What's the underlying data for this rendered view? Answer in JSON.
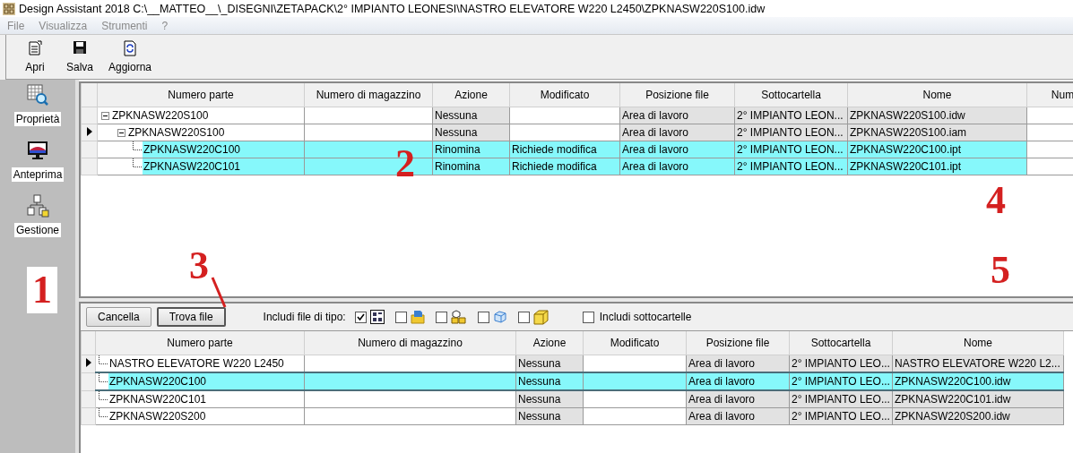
{
  "window": {
    "title": "Design Assistant 2018 C:\\__MATTEO__\\_DISEGNI\\ZETAPACK\\2° IMPIANTO LEONESI\\NASTRO ELEVATORE W220 L2450\\ZPKNASW220S100.idw"
  },
  "menu": [
    {
      "label": "File",
      "disabled": true
    },
    {
      "label": "Visualizza",
      "disabled": true
    },
    {
      "label": "Strumenti",
      "disabled": true
    },
    {
      "label": "?",
      "disabled": true
    }
  ],
  "toolbar": [
    {
      "label": "Apri",
      "kind": "open"
    },
    {
      "label": "Salva",
      "kind": "save"
    },
    {
      "label": "Aggiorna",
      "kind": "refresh"
    }
  ],
  "sidebar": {
    "items": [
      {
        "label": "Proprietà",
        "kind": "properties"
      },
      {
        "label": "Anteprima",
        "kind": "preview"
      },
      {
        "label": "Gestione",
        "kind": "manage"
      }
    ]
  },
  "top_table": {
    "columns": [
      {
        "label": "Numero parte",
        "kind": "tree"
      },
      {
        "label": "Numero di magazzino",
        "kind": "edit"
      },
      {
        "label": "Azione",
        "kind": "readonly"
      },
      {
        "label": "Modificato",
        "kind": "edit"
      },
      {
        "label": "Posizione file",
        "kind": "readonly"
      },
      {
        "label": "Sottocartella",
        "kind": "readonly"
      },
      {
        "label": "Nome",
        "kind": "readonly"
      },
      {
        "label": "Num",
        "kind": "plain"
      }
    ],
    "rows": [
      {
        "cells": [
          "ZPKNASW220S100",
          null,
          "Nessuna",
          null,
          "Area di lavoro",
          "2° IMPIANTO LEON...",
          "ZPKNASW220S100.idw",
          null
        ],
        "current": false,
        "selected": false,
        "expanded": true,
        "children": [
          {
            "cells": [
              "ZPKNASW220S100",
              null,
              "Nessuna",
              null,
              "Area di lavoro",
              "2° IMPIANTO LEON...",
              "ZPKNASW220S100.iam",
              null
            ],
            "current": true,
            "selected": false,
            "expanded": true,
            "children": [
              {
                "cells": [
                  "ZPKNASW220C100",
                  null,
                  "Rinomina",
                  "Richiede modifica",
                  "Area di lavoro",
                  "2° IMPIANTO LEON...",
                  "ZPKNASW220C100.ipt",
                  null
                ],
                "current": false,
                "selected": true
              },
              {
                "cells": [
                  "ZPKNASW220C101",
                  null,
                  "Rinomina",
                  "Richiede modifica",
                  "Area di lavoro",
                  "2° IMPIANTO LEON...",
                  "ZPKNASW220C101.ipt",
                  null
                ],
                "current": false,
                "selected": true
              }
            ]
          }
        ]
      }
    ]
  },
  "search_bar": {
    "buttons": [
      {
        "label": "Cancella",
        "default": false
      },
      {
        "label": "Trova file",
        "default": true
      }
    ],
    "file_types_label": "Includi file di tipo:",
    "file_types": [
      {
        "kind": "drawing",
        "checked": true
      },
      {
        "kind": "presentation",
        "checked": false
      },
      {
        "kind": "assembly",
        "checked": false
      },
      {
        "kind": "surface",
        "checked": false
      },
      {
        "kind": "part",
        "checked": false
      }
    ],
    "subfolders": {
      "label": "Includi sottocartelle",
      "checked": false
    }
  },
  "bottom_table": {
    "columns": [
      {
        "label": "Numero parte",
        "kind": "tree"
      },
      {
        "label": "Numero di magazzino",
        "kind": "edit"
      },
      {
        "label": "Azione",
        "kind": "readonly"
      },
      {
        "label": "Modificato",
        "kind": "edit"
      },
      {
        "label": "Posizione file",
        "kind": "readonly"
      },
      {
        "label": "Sottocartella",
        "kind": "readonly"
      },
      {
        "label": "Nome",
        "kind": "readonly"
      }
    ],
    "rows": [
      {
        "cells": [
          "NASTRO ELEVATORE W220 L2450",
          null,
          "Nessuna",
          null,
          "Area di lavoro",
          "2° IMPIANTO LEO...",
          "NASTRO ELEVATORE W220 L2..."
        ],
        "current": true,
        "selected": false
      },
      {
        "cells": [
          "ZPKNASW220C100",
          null,
          "Nessuna",
          null,
          "Area di lavoro",
          "2° IMPIANTO LEO...",
          "ZPKNASW220C100.idw"
        ],
        "current": false,
        "selected": true
      },
      {
        "cells": [
          "ZPKNASW220C101",
          null,
          "Nessuna",
          null,
          "Area di lavoro",
          "2° IMPIANTO LEO...",
          "ZPKNASW220C101.idw"
        ],
        "current": false,
        "selected": false
      },
      {
        "cells": [
          "ZPKNASW220S200",
          null,
          "Nessuna",
          null,
          "Area di lavoro",
          "2° IMPIANTO LEO...",
          "ZPKNASW220S200.idw"
        ],
        "current": false,
        "selected": false
      }
    ]
  },
  "annotations": [
    {
      "label": "1"
    },
    {
      "label": "2"
    },
    {
      "label": "3"
    },
    {
      "label": "4"
    },
    {
      "label": "5"
    }
  ]
}
